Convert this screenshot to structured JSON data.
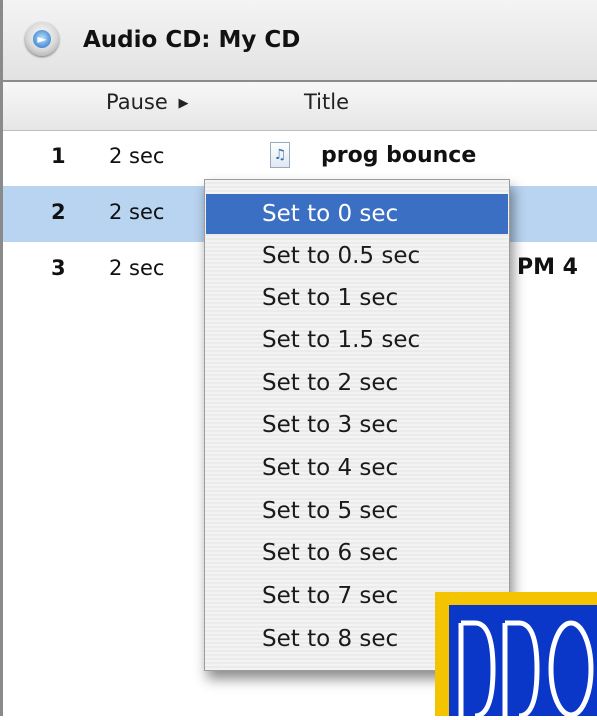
{
  "window": {
    "title": "Audio CD:  My CD",
    "app_icon": "audio-cd-icon"
  },
  "columns": {
    "pause": "Pause",
    "title": "Title"
  },
  "tracks": [
    {
      "number": "1",
      "pause": "2 sec",
      "title": "prog bounce"
    },
    {
      "number": "2",
      "pause": "2 sec",
      "title": ""
    },
    {
      "number": "3",
      "pause": "2 sec",
      "title": "PM 4"
    }
  ],
  "selected_track": 2,
  "context_menu": {
    "highlighted_index": 0,
    "items": [
      "Set to 0 sec",
      "Set to 0.5 sec",
      "Set to 1 sec",
      "Set to 1.5 sec",
      "Set to 2 sec",
      "Set to 3 sec",
      "Set to 4 sec",
      "Set to 5 sec",
      "Set to 6 sec",
      "Set to 7 sec",
      "Set to 8 sec"
    ]
  },
  "watermark": {
    "text": "DDO"
  },
  "colors": {
    "selection_row": "#b9d4f1",
    "menu_highlight": "#3a6fc4",
    "logo_yellow": "#f5c400",
    "logo_blue": "#0b37c8"
  }
}
